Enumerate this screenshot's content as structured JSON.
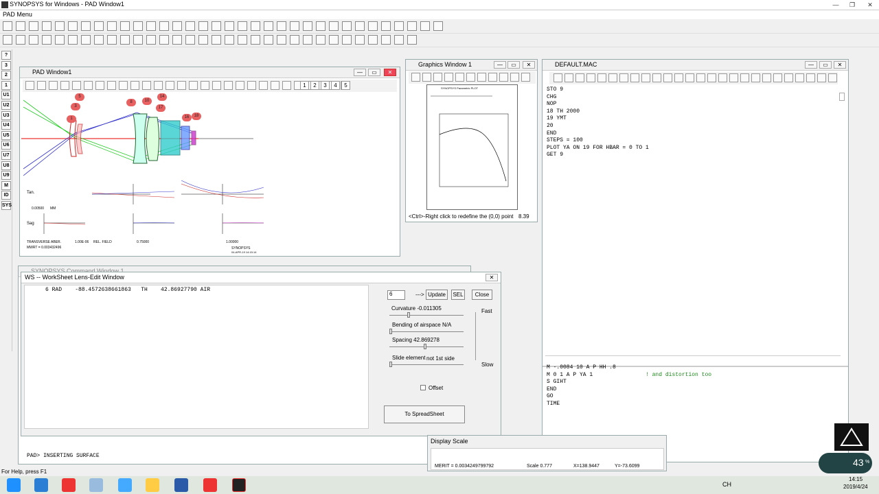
{
  "app": {
    "title": "SYNOPSYS for Windows - PAD Window1",
    "menu": "PAD Menu"
  },
  "left_toolbar": [
    "?",
    "3",
    "2",
    "1",
    "U1",
    "U2",
    "U3",
    "U4",
    "U5",
    "U6",
    "U7",
    "U8",
    "U9",
    "M",
    "ID",
    "SYS"
  ],
  "pad_window": {
    "title": "PAD Window1",
    "toolbar_numbers": [
      "1",
      "2",
      "3",
      "4",
      "5"
    ],
    "surface_labels": [
      "1",
      "3",
      "5",
      "8",
      "10",
      "14",
      "17",
      "16",
      "18"
    ],
    "plot": {
      "tan": "Tan.",
      "sag": "Sag",
      "scale": "0.00500",
      "scale_unit": "MM",
      "transverse": "TRANSVERSE ABER.",
      "wavelength": "1.00E-06",
      "rel_field": "REL. FIELD",
      "field_mid": "0.75000",
      "field_full": "1.00000",
      "mwrt": "MWRT = 0.003432496",
      "brand": "SYNOPSYS",
      "date": "04-APR-19 14:15:14"
    }
  },
  "graphics_window": {
    "title": "Graphics Window 1",
    "plot_title": "SYNOPSYS Parametric PLOT",
    "status": "<Ctrl>-Right click to redefine the (0,0) point",
    "status_value": "8.39"
  },
  "macro_window": {
    "title": "DEFAULT.MAC",
    "lines": [
      "STO 9",
      "CHG",
      "NOP",
      "18 TH 2000",
      "19 YMT",
      "20",
      "END",
      "STEPS = 100",
      "PLOT YA ON 19 FOR HBAR = 0 TO 1",
      "GET 9"
    ],
    "lower_lines": [
      {
        "text": "M -.0084 10 A P HH .8",
        "comment": ""
      },
      {
        "text": "M 0 1 A P YA 1",
        "comment": "! and distortion too"
      },
      {
        "text": "S GIHT",
        "comment": ""
      },
      {
        "text": "END",
        "comment": ""
      },
      {
        "text": "GO",
        "comment": ""
      },
      {
        "text": "TIME",
        "comment": ""
      }
    ]
  },
  "command_window": {
    "title": "SYNOPSYS Command Window 1",
    "prompt_line": "PAD> INSERTING SURFACE"
  },
  "ws_window": {
    "title": "WS -- WorkSheet Lens-Edit Window",
    "surface_line": "6 RAD    -88.4572638661863   TH    42.86927790 AIR",
    "surface_input": "6",
    "arrow": "--->",
    "update": "Update",
    "sel": "SEL",
    "close": "Close",
    "curvature": "Curvature -0.011305",
    "bending": "Bending of airspace N/A",
    "spacing": "Spacing 42.869278",
    "slide": "Slide element",
    "slide_value": "not 1st side",
    "fast": "Fast",
    "slow": "Slow",
    "offset": "Offset",
    "to_spreadsheet": "To SpreadSheet"
  },
  "display_scale": {
    "title": "Display Scale",
    "merit": "MERIT = 0.0034249799792",
    "scale": "Scale 0.777",
    "x": "X=138.9447",
    "y": "Y=-73.6099"
  },
  "status_bar": "For Help, press F1",
  "taskbar": {
    "lang": "CH",
    "time": "14:15",
    "date": "2019/4/24",
    "battery": "43",
    "battery_unit": "%"
  },
  "colors": {
    "titlebar": "#ffffff",
    "close_red": "#e04050",
    "taskbar": "#dfe7df",
    "comment_green": "#1a8a1a"
  }
}
